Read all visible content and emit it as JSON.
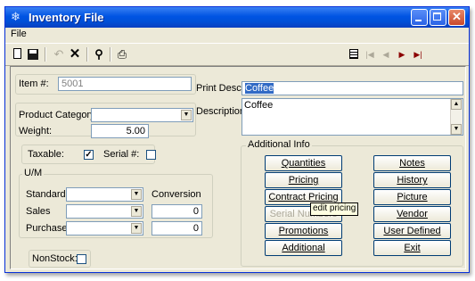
{
  "window": {
    "title": "Inventory File"
  },
  "menu": {
    "file": "File"
  },
  "toolbar": {
    "icons": [
      "new-icon",
      "save-icon",
      "undo-icon",
      "delete-icon",
      "find-icon",
      "print-icon",
      "list-icon",
      "first-icon",
      "prev-icon",
      "next-icon",
      "last-icon"
    ]
  },
  "form": {
    "item_label": "Item #:",
    "item_value": "5001",
    "product_category_label": "Product Category:",
    "product_category_value": "",
    "weight_label": "Weight:",
    "weight_value": "5.00",
    "taxable_label": "Taxable:",
    "taxable_checked": true,
    "serial_label": "Serial #:",
    "serial_checked": false,
    "print_desc_label": "Print Desc:",
    "print_desc_value": "Coffee",
    "description_label": "Description:",
    "description_value": "Coffee",
    "nonstock_label": "NonStock:"
  },
  "um": {
    "title": "U/M",
    "conversion_label": "Conversion",
    "standard_label": "Standard",
    "sales_label": "Sales",
    "purchase_label": "Purchase",
    "sales_conversion": "0",
    "purchase_conversion": "0"
  },
  "additional_info": {
    "title": "Additional Info",
    "left_buttons": [
      {
        "label": "Quantities",
        "enabled": true
      },
      {
        "label": "Pricing",
        "enabled": true
      },
      {
        "label": "Contract Pricing",
        "enabled": true
      },
      {
        "label": "Serial Numbers",
        "enabled": false
      },
      {
        "label": "Promotions",
        "enabled": true
      },
      {
        "label": "Additional",
        "enabled": true
      }
    ],
    "right_buttons": [
      {
        "label": "Notes",
        "enabled": true
      },
      {
        "label": "History",
        "enabled": true
      },
      {
        "label": "Picture",
        "enabled": true
      },
      {
        "label": "Vendor",
        "enabled": true
      },
      {
        "label": "User Defined",
        "enabled": true
      },
      {
        "label": "Exit",
        "enabled": true
      }
    ],
    "tooltip": "edit pricing"
  },
  "colors": {
    "title_bar": "#0054e3",
    "window_bg": "#ece9d8",
    "selection": "#316ac5"
  }
}
